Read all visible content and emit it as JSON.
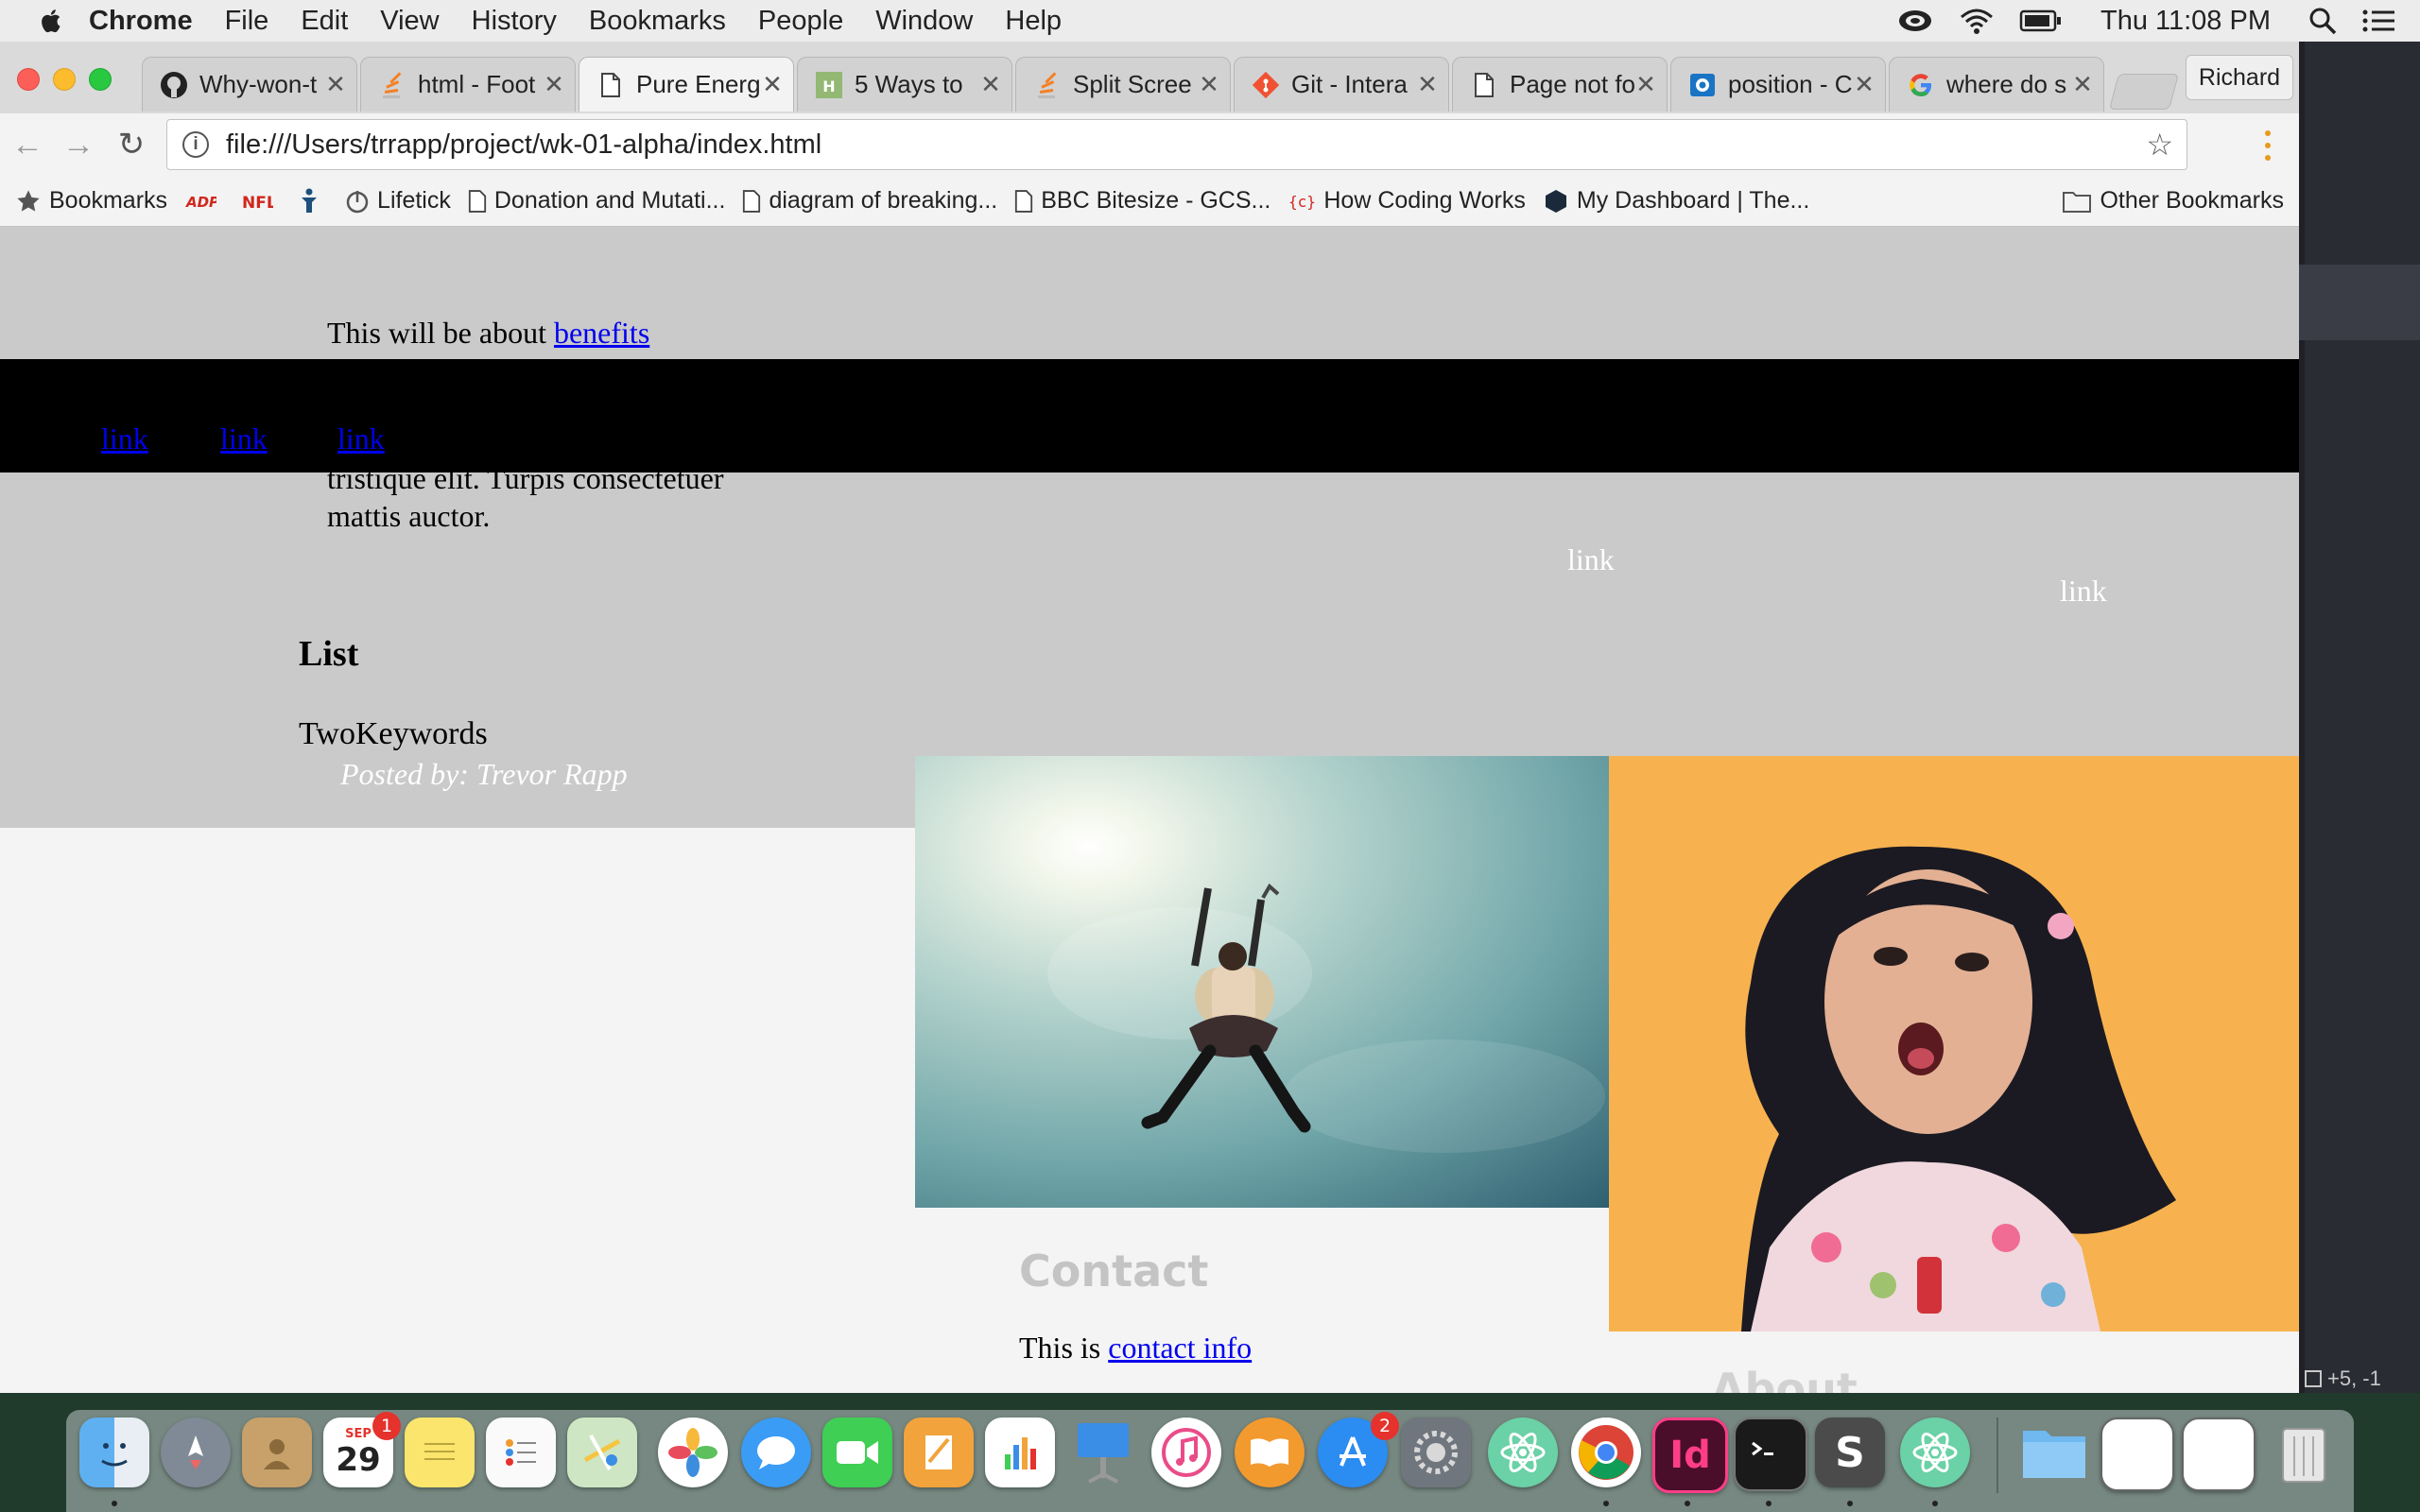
{
  "menubar": {
    "app_name": "Chrome",
    "items": [
      "File",
      "Edit",
      "View",
      "History",
      "Bookmarks",
      "People",
      "Window",
      "Help"
    ],
    "clock": "Thu 11:08 PM",
    "status_icons": [
      "creative-cloud-icon",
      "wifi-icon",
      "battery-icon",
      "spotlight-icon",
      "notification-center-icon"
    ]
  },
  "tabs": [
    {
      "label": "Why-won-t",
      "icon": "github-icon",
      "active": false
    },
    {
      "label": "html - Foot",
      "icon": "stackoverflow-icon",
      "active": false
    },
    {
      "label": "Pure Energ",
      "icon": "page-icon",
      "active": true
    },
    {
      "label": "5 Ways to",
      "icon": "wikihow-icon",
      "active": false
    },
    {
      "label": "Split Scree",
      "icon": "stackoverflow-icon",
      "active": false
    },
    {
      "label": "Git - Intera",
      "icon": "git-icon",
      "active": false
    },
    {
      "label": "Page not fo",
      "icon": "page-icon",
      "active": false
    },
    {
      "label": "position - C",
      "icon": "site-icon",
      "active": false
    },
    {
      "label": "where do s",
      "icon": "google-icon",
      "active": false
    }
  ],
  "profile_button": "Richard",
  "address_bar": {
    "url": "file:///Users/trrapp/project/wk-01-alpha/index.html"
  },
  "bookmarks": [
    {
      "label": "Bookmarks",
      "icon": "star-icon"
    },
    {
      "label": "",
      "icon": "adp-icon"
    },
    {
      "label": "",
      "icon": "nfl-icon"
    },
    {
      "label": "",
      "icon": "figure-icon"
    },
    {
      "label": "Lifetick",
      "icon": "lifetick-icon"
    },
    {
      "label": "Donation and Mutati...",
      "icon": "page-icon"
    },
    {
      "label": "diagram of breaking...",
      "icon": "page-icon"
    },
    {
      "label": "BBC Bitesize - GCS...",
      "icon": "page-icon"
    },
    {
      "label": "How Coding Works",
      "icon": "code-icon"
    },
    {
      "label": "My Dashboard | The...",
      "icon": "hexagon-icon"
    }
  ],
  "other_bookmarks": "Other Bookmarks",
  "page": {
    "intro_prefix": "This will be about ",
    "intro_link": "benefits",
    "nav_links": [
      "link",
      "link",
      "link"
    ],
    "para_line1": "tristique elit. Turpis consectetuer",
    "para_line2": "mattis auctor.",
    "right_links": [
      "link",
      "link"
    ],
    "list_heading": "List",
    "keywords": "TwoKeywords",
    "posted_by": "Posted by: Trevor Rapp",
    "contact_heading": "Contact",
    "contact_prefix": "This is ",
    "contact_link": "contact info",
    "about_heading": "About"
  },
  "editor_status": "+5, -1",
  "dock": {
    "apps": [
      "finder",
      "launchpad",
      "contacts",
      "calendar",
      "notes",
      "reminders",
      "maps",
      "photos",
      "messages",
      "facetime",
      "pages",
      "numbers",
      "keynote",
      "itunes",
      "ibooks",
      "app-store",
      "system-preferences",
      "atom",
      "chrome",
      "indesign",
      "terminal",
      "sketch",
      "atom"
    ],
    "calendar_month": "SEP",
    "calendar_day": "29",
    "calendar_badge": "1",
    "appstore_badge": "2"
  },
  "colors": {
    "gray_section": "#cacaca",
    "nav_bar": "#000000",
    "link": "#0000ee",
    "photo2_bg": "#f7b24f"
  }
}
